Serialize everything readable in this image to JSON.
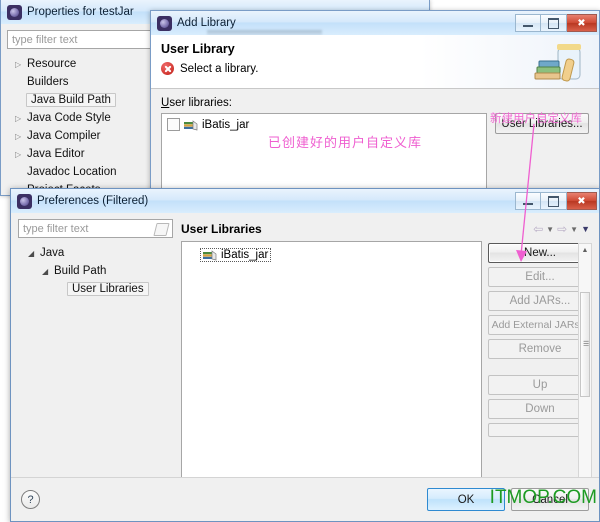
{
  "properties_window": {
    "title": "Properties for testJar",
    "icon": "eclipse-icon",
    "filter": {
      "placeholder": "type filter text",
      "value": ""
    },
    "tree": [
      {
        "label": "Resource",
        "expandable": true,
        "selected": false,
        "indent": 0
      },
      {
        "label": "Builders",
        "expandable": false,
        "selected": false,
        "indent": 0
      },
      {
        "label": "Java Build Path",
        "expandable": false,
        "selected": true,
        "indent": 0
      },
      {
        "label": "Java Code Style",
        "expandable": true,
        "selected": false,
        "indent": 0
      },
      {
        "label": "Java Compiler",
        "expandable": true,
        "selected": false,
        "indent": 0
      },
      {
        "label": "Java Editor",
        "expandable": true,
        "selected": false,
        "indent": 0
      },
      {
        "label": "Javadoc Location",
        "expandable": false,
        "selected": false,
        "indent": 0
      },
      {
        "label": "Project Facets",
        "expandable": false,
        "selected": false,
        "indent": 0
      }
    ]
  },
  "add_library_window": {
    "title": "Add Library",
    "icon": "eclipse-icon",
    "window_buttons": {
      "minimize": "minimize-button",
      "maximize": "maximize-button",
      "close": "close-button"
    },
    "header": {
      "heading": "User Library",
      "message": "Select a library.",
      "message_icon": "error-icon",
      "banner_icon": "jar-books-icon"
    },
    "libraries_label": "User libraries:",
    "libraries": [
      {
        "name": "iBatis_jar",
        "checked": false,
        "icon": "library-books-icon"
      }
    ],
    "user_libraries_button": "User Libraries..."
  },
  "preferences_window": {
    "title": "Preferences (Filtered)",
    "icon": "eclipse-icon",
    "window_buttons": {
      "minimize": "minimize-button",
      "maximize": "maximize-button",
      "close": "close-button"
    },
    "filter": {
      "placeholder": "type filter text",
      "value": ""
    },
    "tree": [
      {
        "label": "Java",
        "expanded": true,
        "indent": 0,
        "selected": false
      },
      {
        "label": "Build Path",
        "expanded": true,
        "indent": 1,
        "selected": false
      },
      {
        "label": "User Libraries",
        "expanded": false,
        "indent": 2,
        "selected": true
      }
    ],
    "page_title": "User Libraries",
    "nav_icons": [
      "back-arrow-icon",
      "back-dropdown-icon",
      "forward-arrow-icon",
      "forward-dropdown-icon",
      "view-menu-icon"
    ],
    "list_items": [
      {
        "name": "iBatis_jar",
        "icon": "library-books-icon",
        "selected": true
      }
    ],
    "buttons": [
      {
        "label": "New...",
        "enabled": true,
        "focused": true
      },
      {
        "label": "Edit...",
        "enabled": false,
        "focused": false
      },
      {
        "label": "Add JARs...",
        "enabled": false,
        "focused": false
      },
      {
        "label": "Add External JARs...",
        "enabled": false,
        "focused": false
      },
      {
        "label": "Remove",
        "enabled": false,
        "focused": false
      },
      {
        "label": "Up",
        "enabled": false,
        "focused": false
      },
      {
        "label": "Down",
        "enabled": false,
        "focused": false
      }
    ],
    "footer": {
      "help": "?",
      "ok": "OK",
      "cancel": "Cancel"
    }
  },
  "annotations": {
    "created_library": "已创建好的用户自定义库",
    "new_user_library": "新建用户自定义库",
    "arrow_color": "#ef5fd0"
  },
  "watermark": "ITMOP.COM"
}
